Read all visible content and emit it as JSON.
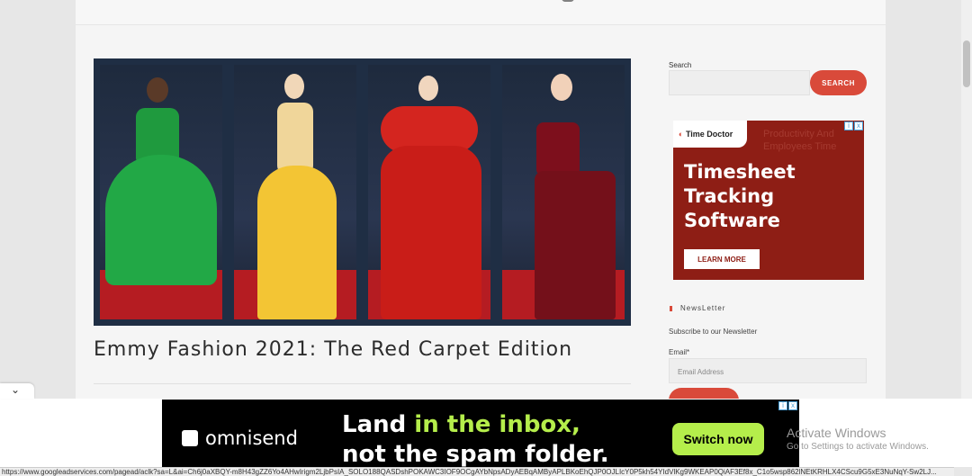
{
  "post": {
    "title": "Emmy Fashion 2021: The Red Carpet Edition",
    "hero_image_alt": "Emmy red carpet dresses collage"
  },
  "sidebar": {
    "search_label": "Search",
    "search_button": "SEARCH",
    "newsletter_title": "NewsLetter",
    "newsletter_sub": "Subscribe to our Newsletter",
    "email_label": "Email*",
    "email_placeholder": "Email Address"
  },
  "sidebar_ad": {
    "brand": "Time Doctor",
    "ghost_text_1": "Productivity And",
    "ghost_text_2": "Employees Time",
    "headline_1": "Timesheet",
    "headline_2": "Tracking",
    "headline_3": "Software",
    "cta": "LEARN MORE"
  },
  "bottom_ad": {
    "brand": "omnisend",
    "line1_a": "Land ",
    "line1_b": "in the inbox,",
    "line2": "not the spam folder.",
    "cta": "Switch now"
  },
  "windows": {
    "activate": "Activate Windows",
    "hint": "Go to Settings to activate Windows."
  },
  "status_bar": {
    "url": "https://www.googleadservices.com/pagead/aclk?sa=L&ai=Ch6j0aXBQY-m8H43gZZ6Yo4AHwIrigm2LjbPsIA_SOLO188QASDshPOKAWC3IOF9OCgAYbNpsADyAEBqAMByAPLBKoEhQJP0OJLIcY0P5kh54YIdVlKg9WKEAP0QiAF3Ef8x_C1o5wsp862lNEtKRHLX4CScu9G5xE3NuNqY-Sw2LJ..."
  }
}
